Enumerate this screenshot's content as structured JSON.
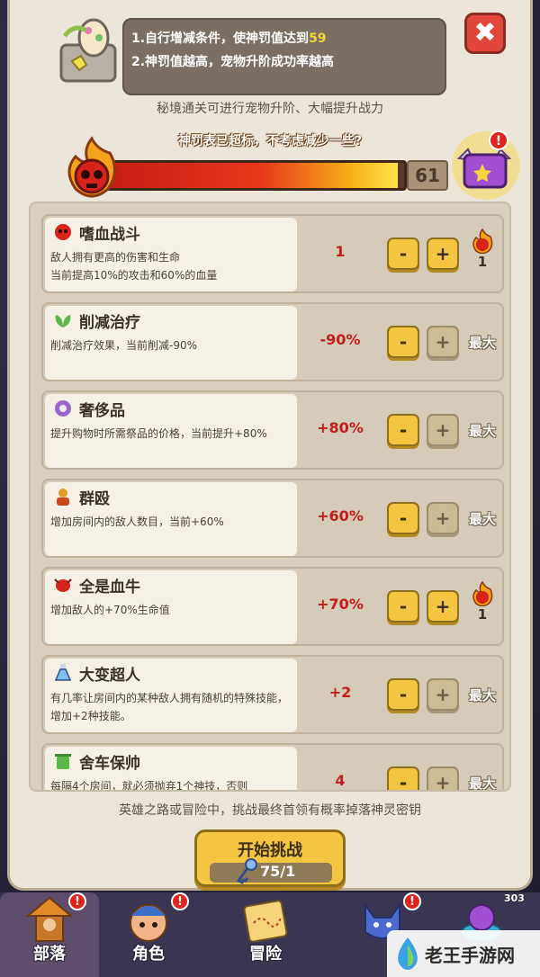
{
  "header": {
    "info_line_1_prefix": "1.自行增减条件，使神罚值达到",
    "info_line_1_target": "59",
    "info_line_2": "2.神罚值越高，宠物升阶成功率越高",
    "close_label": "✖",
    "subtitle": "秘境通关可进行宠物升阶、大幅提升战力",
    "warning": "神罚表已超标，不考虑减少一些?"
  },
  "penalty": {
    "value": "61",
    "target": 59,
    "fill_fraction": 0.98
  },
  "conditions": [
    {
      "title": "嗜血战斗",
      "icon": "blood-skull-icon",
      "desc": "敌人拥有更高的伤害和生命\n当前提高10%的攻击和60%的血量",
      "value": "1",
      "minus": "-",
      "plus": "+",
      "plus_enabled": true,
      "right_type": "level",
      "right_text": "1"
    },
    {
      "title": "削减治疗",
      "icon": "leaf-icon",
      "desc": "削减治疗效果，当前削减-90%",
      "value": "-90%",
      "minus": "-",
      "plus": "+",
      "plus_enabled": false,
      "right_type": "max",
      "right_text": "最大"
    },
    {
      "title": "奢侈品",
      "icon": "gem-icon",
      "desc": "提升购物时所需祭品的价格，当前提升+80%",
      "value": "+80%",
      "minus": "-",
      "plus": "+",
      "plus_enabled": false,
      "right_type": "max",
      "right_text": "最大"
    },
    {
      "title": "群殴",
      "icon": "crowd-icon",
      "desc": "增加房间内的敌人数目，当前+60%",
      "value": "+60%",
      "minus": "-",
      "plus": "+",
      "plus_enabled": false,
      "right_type": "max",
      "right_text": "最大"
    },
    {
      "title": "全是血牛",
      "icon": "bull-icon",
      "desc": "增加敌人的+70%生命值",
      "value": "+70%",
      "minus": "-",
      "plus": "+",
      "plus_enabled": true,
      "right_type": "level",
      "right_text": "1"
    },
    {
      "title": "大变超人",
      "icon": "potion-icon",
      "desc": "有几率让房间内的某种敌人拥有随机的特殊技能，增加+2种技能。",
      "value": "+2",
      "minus": "-",
      "plus": "+",
      "plus_enabled": false,
      "right_type": "max",
      "right_text": "最大"
    },
    {
      "title": "舍车保帅",
      "icon": "trash-icon",
      "desc": "每隔4个房间，就必须抛弃1个神技，否则",
      "value": "4",
      "minus": "-",
      "plus": "+",
      "plus_enabled": false,
      "right_type": "max",
      "right_text": "最大"
    }
  ],
  "footer": {
    "note": "英雄之路或冒险中，挑战最终首领有概率掉落神灵密钥",
    "start_label": "开始挑战",
    "cost": "75/1"
  },
  "nav": {
    "items": [
      {
        "label": "部落",
        "icon": "tribe-icon",
        "badge": "!"
      },
      {
        "label": "角色",
        "icon": "character-icon",
        "badge": "!"
      },
      {
        "label": "冒险",
        "icon": "map-icon",
        "badge": ""
      },
      {
        "label": "",
        "icon": "pet-icon",
        "badge": "!"
      },
      {
        "label": "",
        "icon": "shop-icon",
        "badge": "303"
      }
    ]
  },
  "watermark": "老王手游网",
  "colors": {
    "accent": "#f4c540",
    "danger": "#c01e1a",
    "panel": "#ece6da"
  }
}
